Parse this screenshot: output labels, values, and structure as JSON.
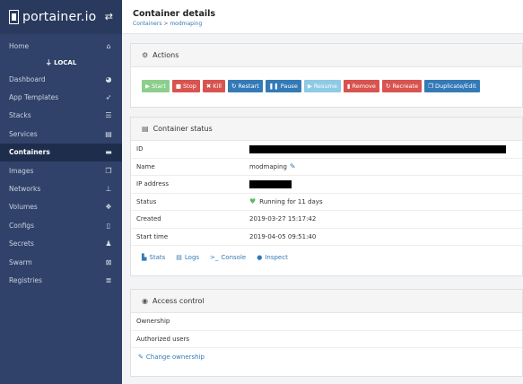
{
  "brand": {
    "name": "portainer.io"
  },
  "sidebar": {
    "home": "Home",
    "endpoint": "LOCAL",
    "items": [
      {
        "label": "Dashboard",
        "icon": "tachometer-icon",
        "glyph": "◕"
      },
      {
        "label": "App Templates",
        "icon": "rocket-icon",
        "glyph": "➶"
      },
      {
        "label": "Stacks",
        "icon": "th-list-icon",
        "glyph": "☰"
      },
      {
        "label": "Services",
        "icon": "list-alt-icon",
        "glyph": "▤"
      },
      {
        "label": "Containers",
        "icon": "server-icon",
        "glyph": "▬",
        "active": true
      },
      {
        "label": "Images",
        "icon": "clone-icon",
        "glyph": "❐"
      },
      {
        "label": "Networks",
        "icon": "sitemap-icon",
        "glyph": "⊥"
      },
      {
        "label": "Volumes",
        "icon": "cubes-icon",
        "glyph": "❖"
      },
      {
        "label": "Configs",
        "icon": "file-code-icon",
        "glyph": "▯"
      },
      {
        "label": "Secrets",
        "icon": "user-secret-icon",
        "glyph": "♟"
      },
      {
        "label": "Swarm",
        "icon": "object-group-icon",
        "glyph": "⊠"
      },
      {
        "label": "Registries",
        "icon": "database-icon",
        "glyph": "≣"
      }
    ]
  },
  "header": {
    "title": "Container details",
    "breadcrumb_root": "Containers",
    "breadcrumb_sep": ">",
    "breadcrumb_current": "modmaping"
  },
  "actions": {
    "title": "Actions",
    "buttons": [
      {
        "label": "Start",
        "style": "success",
        "glyph": "▶",
        "name": "start-button"
      },
      {
        "label": "Stop",
        "style": "danger",
        "glyph": "■",
        "name": "stop-button"
      },
      {
        "label": "Kill",
        "style": "danger",
        "glyph": "✖",
        "name": "kill-button"
      },
      {
        "label": "Restart",
        "style": "primary",
        "glyph": "↻",
        "name": "restart-button"
      },
      {
        "label": "Pause",
        "style": "primary",
        "glyph": "❚❚",
        "name": "pause-button"
      },
      {
        "label": "Resume",
        "style": "info",
        "glyph": "▶",
        "name": "resume-button"
      },
      {
        "label": "Remove",
        "style": "danger",
        "glyph": "▮",
        "name": "remove-button"
      },
      {
        "label": "Recreate",
        "style": "danger",
        "glyph": "↻",
        "name": "recreate-button"
      },
      {
        "label": "Duplicate/Edit",
        "style": "primary",
        "glyph": "❐",
        "name": "duplicate-edit-button"
      }
    ]
  },
  "status": {
    "title": "Container status",
    "labels": {
      "id": "ID",
      "name": "Name",
      "ip": "IP address",
      "status": "Status",
      "created": "Created",
      "start": "Start time"
    },
    "values": {
      "name": "modmaping",
      "status": "Running for 11 days",
      "created": "2019-03-27 15:17:42",
      "start": "2019-04-05 09:51:40"
    },
    "links": {
      "stats": "Stats",
      "logs": "Logs",
      "console": "Console",
      "inspect": "Inspect"
    }
  },
  "access": {
    "title": "Access control",
    "ownership": "Ownership",
    "authorized": "Authorized users",
    "change": "Change ownership"
  },
  "colors": {
    "sidebar": "#30426a",
    "success": "#8ccf8c",
    "danger": "#d9534f",
    "primary": "#337ab7",
    "info": "#8ecae6"
  }
}
